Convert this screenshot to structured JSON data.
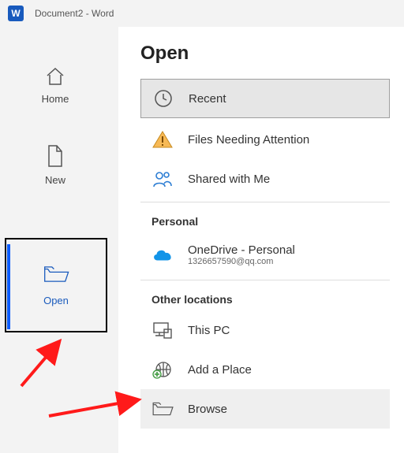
{
  "titlebar": {
    "doc_name": "Document2  -  Word",
    "app_letter": "W"
  },
  "sidebar": {
    "home": "Home",
    "new": "New",
    "open": "Open"
  },
  "main": {
    "heading": "Open",
    "recent": "Recent",
    "files_attention": "Files Needing Attention",
    "shared": "Shared with Me",
    "section_personal": "Personal",
    "onedrive_title": "OneDrive - Personal",
    "onedrive_email": "1326657590@qq.com",
    "section_other": "Other locations",
    "this_pc": "This PC",
    "add_place": "Add a Place",
    "browse": "Browse"
  }
}
